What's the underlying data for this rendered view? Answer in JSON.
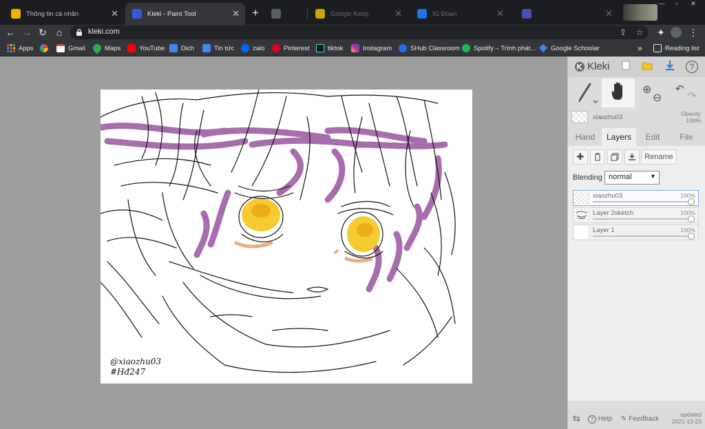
{
  "browser": {
    "tabs": [
      {
        "title": "Thông tin cá nhân",
        "state": "inactive"
      },
      {
        "title": "Kleki - Paint Tool",
        "state": "active"
      },
      {
        "title": "",
        "state": "dim"
      },
      {
        "title": "Google Keep",
        "state": "dim"
      },
      {
        "title": "IG Đoạn",
        "state": "dim"
      },
      {
        "title": "",
        "state": "dim"
      }
    ],
    "new_tab": "+",
    "url": "kleki.com",
    "bookmarks": [
      {
        "label": "Apps",
        "icon": "apps-grid-icon",
        "color": "#ea4335"
      },
      {
        "label": "",
        "icon": "photos-icon",
        "color": "#fbbc04"
      },
      {
        "label": "Gmail",
        "icon": "gmail-icon",
        "color": "#ea4335"
      },
      {
        "label": "Maps",
        "icon": "maps-pin-icon",
        "color": "#34a853"
      },
      {
        "label": "YouTube",
        "icon": "youtube-icon",
        "color": "#ff0000"
      },
      {
        "label": "Dịch",
        "icon": "translate-icon",
        "color": "#4285f4"
      },
      {
        "label": "Tin tức",
        "icon": "news-icon",
        "color": "#4285f4"
      },
      {
        "label": "zalo",
        "icon": "zalo-icon",
        "color": "#0068ff"
      },
      {
        "label": "Pinterest",
        "icon": "pinterest-icon",
        "color": "#e60023"
      },
      {
        "label": "tiktok",
        "icon": "tiktok-icon",
        "color": "#111111"
      },
      {
        "label": "Instagram",
        "icon": "instagram-icon",
        "color": "#d6249f"
      },
      {
        "label": "SHub Classroom",
        "icon": "shub-icon",
        "color": "#1a73e8"
      },
      {
        "label": "Spotify – Trình phát...",
        "icon": "spotify-icon",
        "color": "#1db954"
      },
      {
        "label": "Google Schoolar",
        "icon": "scholar-icon",
        "color": "#4285f4"
      }
    ],
    "bookmarks_more": "»",
    "reading_list": "Reading list"
  },
  "canvas": {
    "signature_line1": "@xiaozhu03",
    "signature_line2": "#Hđ247",
    "colors": {
      "line": "#111111",
      "hair": "#8a3d92",
      "eye": "#f5c518",
      "eye_shadow": "#e07a2a"
    }
  },
  "panel": {
    "logo": "Kleki",
    "brush_name": "xiaozhu03",
    "opacity_label": "Opacity",
    "opacity_value": "100%",
    "tabs": [
      "Hand",
      "Layers",
      "Edit",
      "File"
    ],
    "active_tab": "Layers",
    "rename_label": "Rename",
    "blending_label": "Blending",
    "blending_value": "normal",
    "layers": [
      {
        "name": "xiaozhu03",
        "opacity": "100%",
        "selected": true,
        "thumb": "transparent"
      },
      {
        "name": "Layer 2sketch",
        "opacity": "100%",
        "selected": false,
        "thumb": "sketch"
      },
      {
        "name": "Layer 1",
        "opacity": "100%",
        "selected": false,
        "thumb": "white"
      }
    ],
    "footer": {
      "help": "Help",
      "feedback": "Feedback",
      "updated": "updated",
      "date": "2021-12-23"
    }
  }
}
